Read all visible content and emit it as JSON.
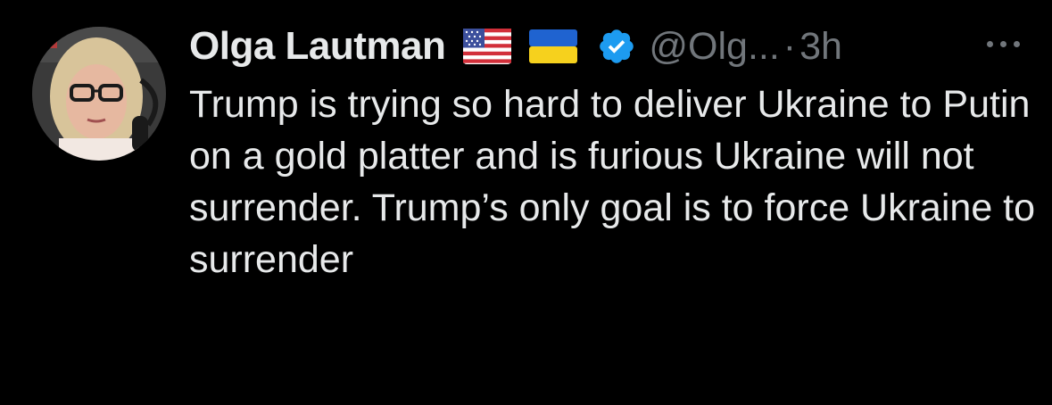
{
  "tweet": {
    "author": {
      "name": "Olga Lautman",
      "handle": "@Olg...",
      "flags": [
        "us-flag-icon",
        "ukraine-flag-icon"
      ],
      "verified": true
    },
    "separator": "·",
    "time": "3h",
    "text": "Trump is trying so hard to deliver Ukraine to Putin on a gold platter and is furious Ukraine will not surrender. Trump’s only goal is to force Ukraine to surrender"
  },
  "colors": {
    "background": "#000000",
    "primary_text": "#e7e9ea",
    "secondary_text": "#71767b",
    "verified_blue": "#1d9bf0"
  }
}
